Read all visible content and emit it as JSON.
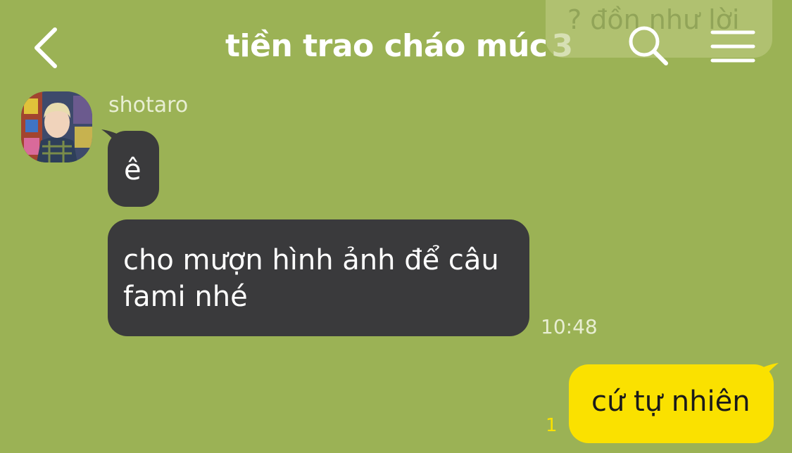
{
  "header": {
    "title": "tiền trao cháo múc",
    "member_count": "3",
    "back_icon": "chevron-left-icon",
    "search_icon": "search-icon",
    "menu_icon": "hamburger-menu-icon"
  },
  "notice": {
    "text": "? đồn như lời"
  },
  "messages": {
    "incoming": {
      "sender": "shotaro",
      "texts": [
        "ê",
        "cho mượn hình ảnh để câu fami nhé"
      ],
      "time": "10:48"
    },
    "outgoing": {
      "text": "cứ tự nhiên",
      "unread_count": "1"
    }
  },
  "colors": {
    "background": "#9bb255",
    "incoming_bubble": "#3a3a3c",
    "outgoing_bubble": "#fae100"
  }
}
